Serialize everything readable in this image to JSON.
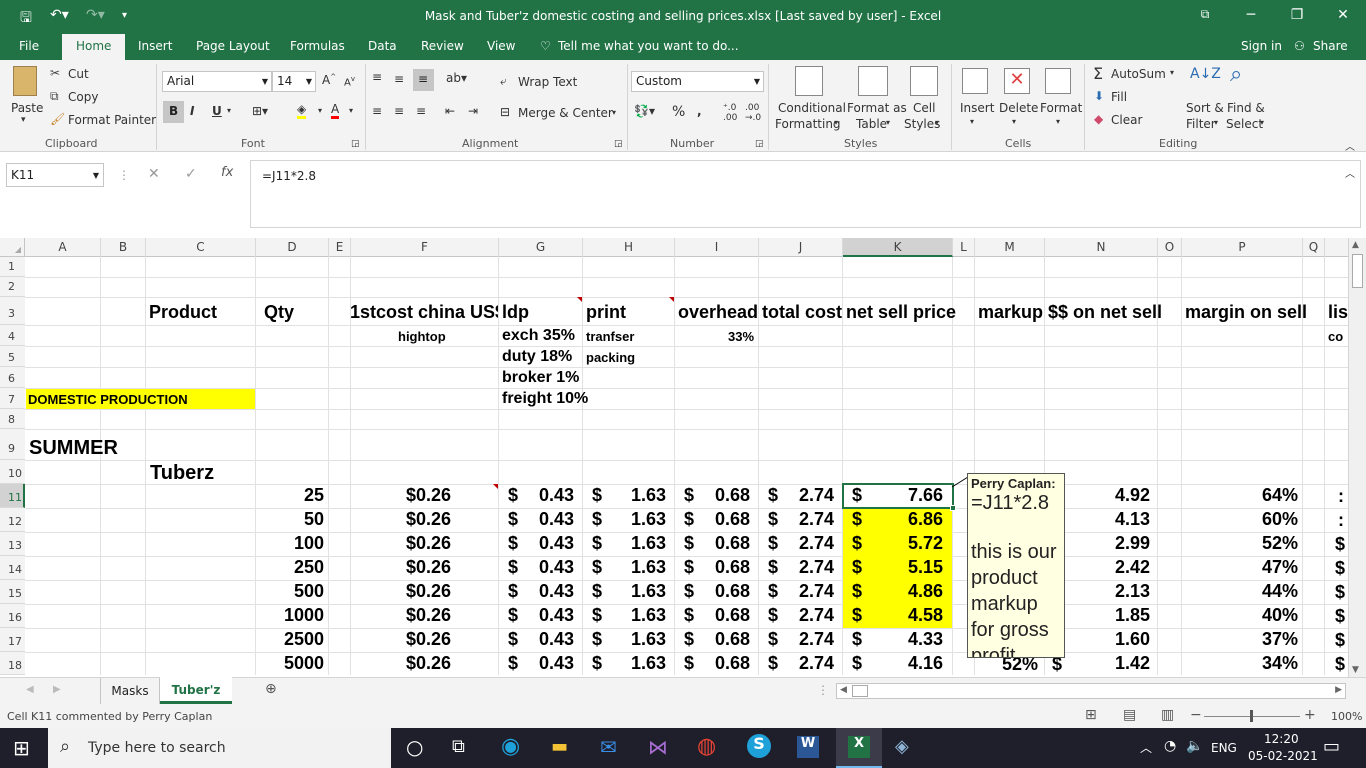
{
  "window": {
    "title": "Mask and Tuber'z domestic costing and selling prices.xlsx [Last saved by user] - Excel"
  },
  "tabs": [
    "File",
    "Home",
    "Insert",
    "Page Layout",
    "Formulas",
    "Data",
    "Review",
    "View"
  ],
  "tell_me": "Tell me what you want to do...",
  "sign_in": "Sign in",
  "share": "Share",
  "ribbon": {
    "clipboard": {
      "paste": "Paste",
      "cut": "Cut",
      "copy": "Copy",
      "format_painter": "Format Painter",
      "label": "Clipboard"
    },
    "font": {
      "name": "Arial",
      "size": "14",
      "label": "Font"
    },
    "alignment": {
      "wrap": "Wrap Text",
      "merge": "Merge & Center",
      "label": "Alignment"
    },
    "number": {
      "format": "Custom",
      "label": "Number"
    },
    "styles": {
      "conditional": "Conditional",
      "formatting": "Formatting",
      "format_as": "Format as",
      "table": "Table",
      "cell": "Cell",
      "styles_btn": "Styles",
      "label": "Styles"
    },
    "cells": {
      "insert": "Insert",
      "delete": "Delete",
      "format": "Format",
      "label": "Cells"
    },
    "editing": {
      "autosum": "AutoSum",
      "fill": "Fill",
      "clear": "Clear",
      "sort1": "Sort &",
      "sort2": "Filter",
      "find1": "Find &",
      "find2": "Select",
      "label": "Editing"
    }
  },
  "formula_bar": {
    "name_box": "K11",
    "formula": "=J11*2.8"
  },
  "columns": [
    "A",
    "B",
    "C",
    "D",
    "E",
    "F",
    "G",
    "H",
    "I",
    "J",
    "K",
    "L",
    "M",
    "N",
    "O",
    "P",
    "Q"
  ],
  "rows": [
    "1",
    "2",
    "3",
    "4",
    "5",
    "6",
    "7",
    "8",
    "9",
    "10",
    "11",
    "12",
    "13",
    "14",
    "15",
    "16",
    "17",
    "18"
  ],
  "headers": {
    "product": "Product",
    "qty": "Qty",
    "firstcost": "1stcost china US$",
    "ldp": "ldp",
    "print": "print",
    "overhead": "overhead",
    "total": "total cost",
    "net": "net sell price",
    "markup": "markup",
    "onnet": "$$ on net sell",
    "margin": "margin on sell",
    "list": "lis",
    "hightop": "hightop",
    "exch": "exch 35%",
    "tranfser": "tranfser",
    "pct33": "33%",
    "co": "co",
    "duty": "duty 18%",
    "packing": "packing",
    "broker": "broker 1%",
    "freight": "freight 10%",
    "domestic": "DOMESTIC PRODUCTION",
    "summer": "SUMMER",
    "tuberz": "Tuberz"
  },
  "data_rows": [
    {
      "qty": "25",
      "first": "$0.26",
      "ldp": "0.43",
      "print": "1.63",
      "over": "0.68",
      "total": "2.74",
      "net": "7.66",
      "dol": "4.92",
      "margin": "64%"
    },
    {
      "qty": "50",
      "first": "$0.26",
      "ldp": "0.43",
      "print": "1.63",
      "over": "0.68",
      "total": "2.74",
      "net": "6.86",
      "dol": "4.13",
      "margin": "60%"
    },
    {
      "qty": "100",
      "first": "$0.26",
      "ldp": "0.43",
      "print": "1.63",
      "over": "0.68",
      "total": "2.74",
      "net": "5.72",
      "dol": "2.99",
      "margin": "52%"
    },
    {
      "qty": "250",
      "first": "$0.26",
      "ldp": "0.43",
      "print": "1.63",
      "over": "0.68",
      "total": "2.74",
      "net": "5.15",
      "dol": "2.42",
      "margin": "47%"
    },
    {
      "qty": "500",
      "first": "$0.26",
      "ldp": "0.43",
      "print": "1.63",
      "over": "0.68",
      "total": "2.74",
      "net": "4.86",
      "dol": "2.13",
      "margin": "44%"
    },
    {
      "qty": "1000",
      "first": "$0.26",
      "ldp": "0.43",
      "print": "1.63",
      "over": "0.68",
      "total": "2.74",
      "net": "4.58",
      "dol": "1.85",
      "margin": "40%"
    },
    {
      "qty": "2500",
      "first": "$0.26",
      "ldp": "0.43",
      "print": "1.63",
      "over": "0.68",
      "total": "2.74",
      "net": "4.33",
      "dol": "1.60",
      "margin": "37%"
    },
    {
      "qty": "5000",
      "first": "$0.26",
      "ldp": "0.43",
      "print": "1.63",
      "over": "0.68",
      "total": "2.74",
      "net": "4.16",
      "dol": "1.42",
      "margin": "34%"
    }
  ],
  "comment": {
    "author": "Perry Caplan:",
    "line1": "=J11*2.8",
    "line2": "this is our",
    "line3": "product",
    "line4": "markup",
    "line5": "for gross",
    "line6": "profit",
    "markup18": "52%"
  },
  "sheets": [
    "Masks",
    "Tuber'z"
  ],
  "status": {
    "text": "Cell K11 commented by Perry Caplan",
    "zoom": "100%"
  },
  "taskbar": {
    "search": "Type here to search",
    "lang": "ENG",
    "time": "12:20",
    "date": "05-02-2021"
  }
}
